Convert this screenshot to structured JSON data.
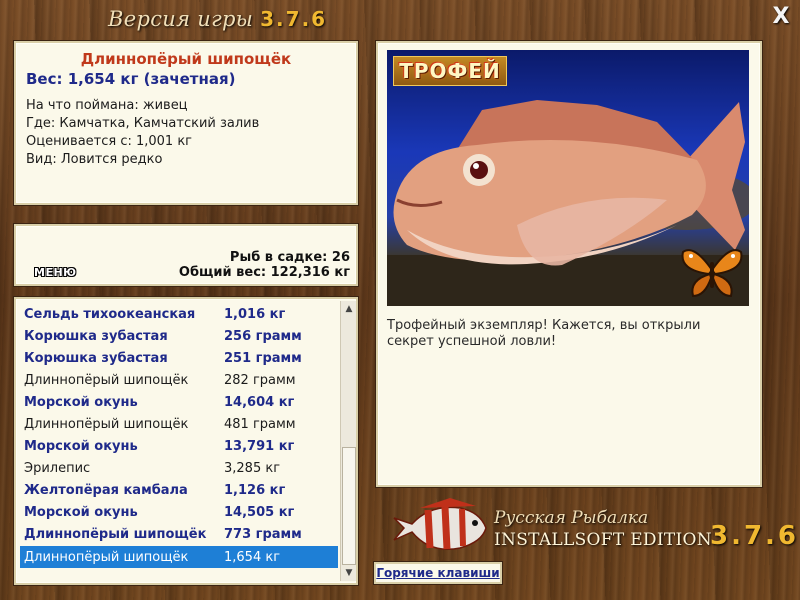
{
  "window": {
    "title_prefix": "Версия игры",
    "title_version": "3.7.6",
    "close_label": "X"
  },
  "fish_info": {
    "name": "Длиннопёрый шипощёк",
    "weight": "Вес: 1,654 кг (зачетная)",
    "lines": [
      "На что поймана: живец",
      "Где: Камчатка, Камчатский залив",
      "Оценивается с: 1,001 кг",
      "Вид: Ловится редко"
    ]
  },
  "stats": {
    "menu_label": "МЕНЮ",
    "fish_count": "Рыб в садке: 26",
    "total_weight": "Общий вес: 122,316 кг"
  },
  "catch_list": [
    {
      "name": "Сельдь тихоокеанская",
      "weight": "1,016 кг",
      "style": "bold"
    },
    {
      "name": "Корюшка зубастая",
      "weight": "256 грамм",
      "style": "bold"
    },
    {
      "name": "Корюшка зубастая",
      "weight": "251 грамм",
      "style": "bold"
    },
    {
      "name": "Длиннопёрый шипощёк",
      "weight": "282 грамм",
      "style": "normal"
    },
    {
      "name": "Морской окунь",
      "weight": "14,604 кг",
      "style": "bold"
    },
    {
      "name": "Длиннопёрый шипощёк",
      "weight": "481 грамм",
      "style": "normal"
    },
    {
      "name": "Морской окунь",
      "weight": "13,791 кг",
      "style": "bold"
    },
    {
      "name": "Эрилепис",
      "weight": "3,285 кг",
      "style": "normal"
    },
    {
      "name": "Желтопёрая камбала",
      "weight": "1,126 кг",
      "style": "bold"
    },
    {
      "name": "Морской окунь",
      "weight": "14,505 кг",
      "style": "bold"
    },
    {
      "name": "Длиннопёрый шипощёк",
      "weight": "773 грамм",
      "style": "bold"
    },
    {
      "name": "Длиннопёрый шипощёк",
      "weight": "1,654 кг",
      "style": "sel"
    }
  ],
  "trophy": {
    "badge": "ТРОФЕЙ",
    "description": "Трофейный экземпляр! Кажется, вы открыли секрет успешной ловли!"
  },
  "logo": {
    "line1": "Русская Рыбалка",
    "line2": "INSTALLSOFT EDITION",
    "version": "3.7.6"
  },
  "hotkeys_label": "Горячие клавиши",
  "colors": {
    "name_red": "#c0391b",
    "list_blue": "#1f2a8a",
    "selection": "#1e7fd6",
    "version_gold": "#f0b830"
  },
  "icons": [
    "close-icon",
    "fish-photo",
    "butterfly-icon",
    "fish-logo-icon",
    "scroll-up-icon",
    "scroll-down-icon"
  ]
}
